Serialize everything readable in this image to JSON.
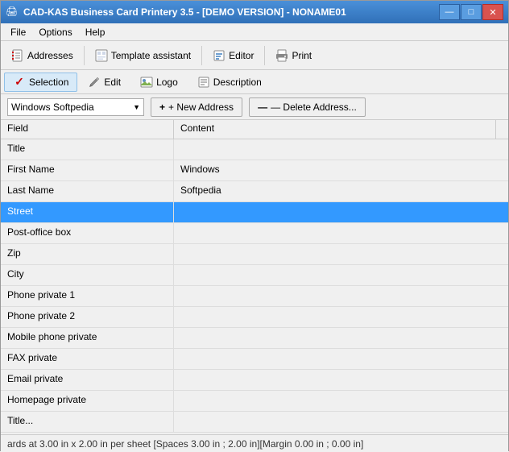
{
  "window": {
    "title": "CAD-KAS Business Card Printery 3.5 - [DEMO VERSION] - NONAME01",
    "icon": "🖨"
  },
  "menubar": {
    "items": [
      {
        "label": "File",
        "id": "file"
      },
      {
        "label": "Options",
        "id": "options"
      },
      {
        "label": "Help",
        "id": "help"
      }
    ]
  },
  "toolbar": {
    "buttons": [
      {
        "label": "Addresses",
        "id": "addresses",
        "icon": "address-book-icon"
      },
      {
        "label": "Template assistant",
        "id": "template-assistant",
        "icon": "template-icon"
      },
      {
        "label": "Editor",
        "id": "editor",
        "icon": "editor-icon"
      },
      {
        "label": "Print",
        "id": "print",
        "icon": "print-icon"
      }
    ]
  },
  "tabbar": {
    "tabs": [
      {
        "label": "Selection",
        "id": "selection",
        "active": true,
        "icon": "check-icon"
      },
      {
        "label": "Edit",
        "id": "edit",
        "icon": "edit-icon"
      },
      {
        "label": "Logo",
        "id": "logo",
        "icon": "logo-icon"
      },
      {
        "label": "Description",
        "id": "description",
        "icon": "description-icon"
      }
    ]
  },
  "addressbar": {
    "dropdown_value": "Windows Softpedia",
    "dropdown_arrow": "▼",
    "new_address_label": "+ New Address",
    "delete_address_label": "— Delete Address..."
  },
  "table": {
    "headers": [
      "Field",
      "Content"
    ],
    "rows": [
      {
        "field": "Title",
        "content": "",
        "selected": false
      },
      {
        "field": "First Name",
        "content": "Windows",
        "selected": false
      },
      {
        "field": "Last Name",
        "content": "Softpedia",
        "selected": false
      },
      {
        "field": "Street",
        "content": "",
        "selected": true
      },
      {
        "field": "Post-office box",
        "content": "",
        "selected": false
      },
      {
        "field": "Zip",
        "content": "",
        "selected": false
      },
      {
        "field": "City",
        "content": "",
        "selected": false
      },
      {
        "field": "Phone private 1",
        "content": "",
        "selected": false
      },
      {
        "field": "Phone private 2",
        "content": "",
        "selected": false
      },
      {
        "field": "Mobile phone private",
        "content": "",
        "selected": false
      },
      {
        "field": "FAX private",
        "content": "",
        "selected": false
      },
      {
        "field": "Email private",
        "content": "",
        "selected": false
      },
      {
        "field": "Homepage private",
        "content": "",
        "selected": false
      },
      {
        "field": "Title...",
        "content": "",
        "selected": false
      }
    ]
  },
  "statusbar": {
    "text": "ards at 3.00 in x 2.00 in per sheet [Spaces 3.00 in ; 2.00 in][Margin 0.00 in ; 0.00 in]"
  },
  "titlebar": {
    "minimize": "—",
    "maximize": "□",
    "close": "✕"
  }
}
